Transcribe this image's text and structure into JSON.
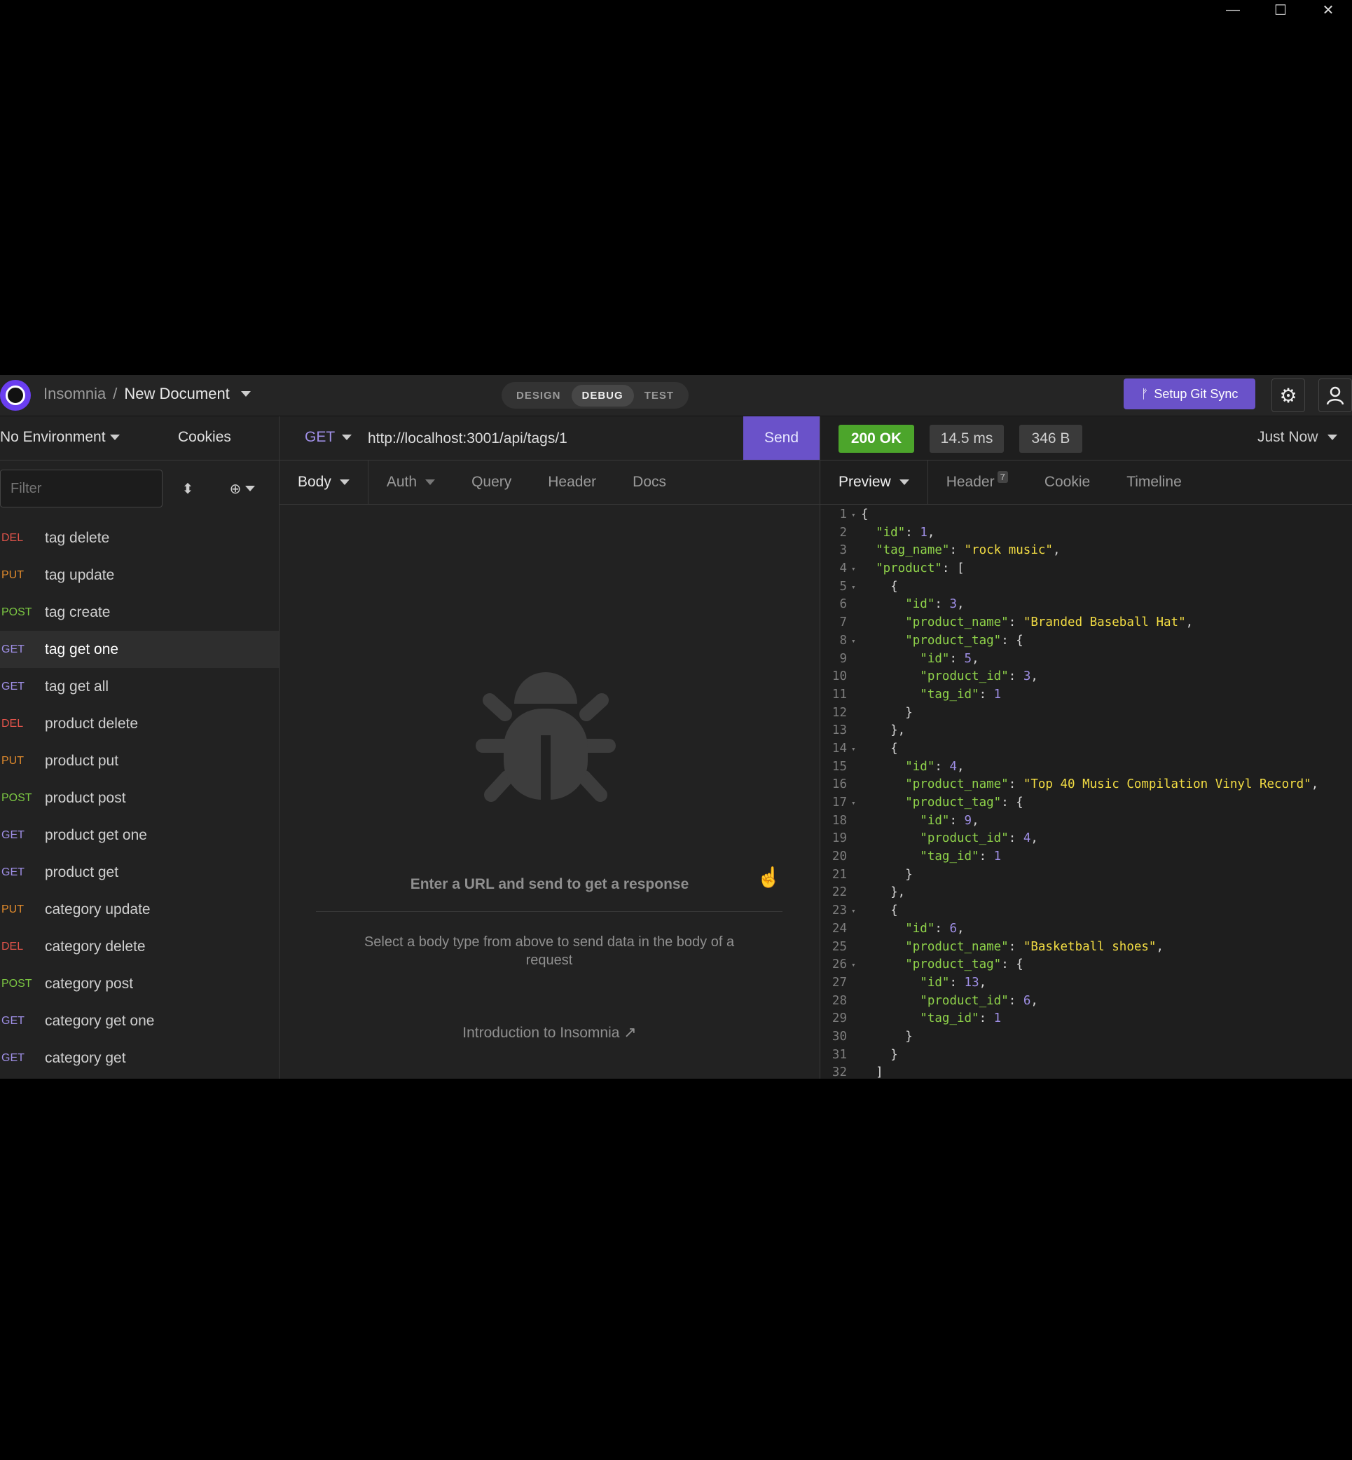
{
  "window_controls": {
    "minimize": "—",
    "maximize": "☐",
    "close": "✕"
  },
  "topbar": {
    "app_name": "Insomnia",
    "separator": "/",
    "document": "New Document",
    "modes": [
      "DESIGN",
      "DEBUG",
      "TEST"
    ],
    "active_mode": "DEBUG",
    "git_sync": "Setup Git Sync"
  },
  "sidebar": {
    "environment": "No Environment",
    "cookies": "Cookies",
    "filter_placeholder": "Filter",
    "requests": [
      {
        "method": "DEL",
        "name": "tag delete"
      },
      {
        "method": "PUT",
        "name": "tag update"
      },
      {
        "method": "POST",
        "name": "tag create"
      },
      {
        "method": "GET",
        "name": "tag get one",
        "active": true
      },
      {
        "method": "GET",
        "name": "tag get all"
      },
      {
        "method": "DEL",
        "name": "product delete"
      },
      {
        "method": "PUT",
        "name": "product put"
      },
      {
        "method": "POST",
        "name": "product post"
      },
      {
        "method": "GET",
        "name": "product get one"
      },
      {
        "method": "GET",
        "name": "product get"
      },
      {
        "method": "PUT",
        "name": "category update"
      },
      {
        "method": "DEL",
        "name": "category delete"
      },
      {
        "method": "POST",
        "name": "category post"
      },
      {
        "method": "GET",
        "name": "category get one"
      },
      {
        "method": "GET",
        "name": "category get"
      }
    ]
  },
  "request": {
    "method": "GET",
    "url": "http://localhost:3001/api/tags/1",
    "send": "Send",
    "tabs": [
      "Body",
      "Auth",
      "Query",
      "Header",
      "Docs"
    ],
    "empty_title": "Enter a URL and send to get a response",
    "empty_sub": "Select a body type from above to send data in the body of a request",
    "intro_link": "Introduction to Insomnia"
  },
  "response": {
    "status": "200 OK",
    "time": "14.5 ms",
    "size": "346 B",
    "when": "Just Now",
    "tabs": [
      "Preview",
      "Header",
      "Cookie",
      "Timeline"
    ],
    "header_count": "7",
    "lines": [
      "{",
      "  \"id\": 1,",
      "  \"tag_name\": \"rock music\",",
      "  \"product\": [",
      "    {",
      "      \"id\": 3,",
      "      \"product_name\": \"Branded Baseball Hat\",",
      "      \"product_tag\": {",
      "        \"id\": 5,",
      "        \"product_id\": 3,",
      "        \"tag_id\": 1",
      "      }",
      "    },",
      "    {",
      "      \"id\": 4,",
      "      \"product_name\": \"Top 40 Music Compilation Vinyl Record\",",
      "      \"product_tag\": {",
      "        \"id\": 9,",
      "        \"product_id\": 4,",
      "        \"tag_id\": 1",
      "      }",
      "    },",
      "    {",
      "      \"id\": 6,",
      "      \"product_name\": \"Basketball shoes\",",
      "      \"product_tag\": {",
      "        \"id\": 13,",
      "        \"product_id\": 6,",
      "        \"tag_id\": 1",
      "      }",
      "    }",
      "  ]"
    ],
    "fold_lines": [
      1,
      4,
      5,
      8,
      14,
      17,
      23,
      26
    ]
  }
}
